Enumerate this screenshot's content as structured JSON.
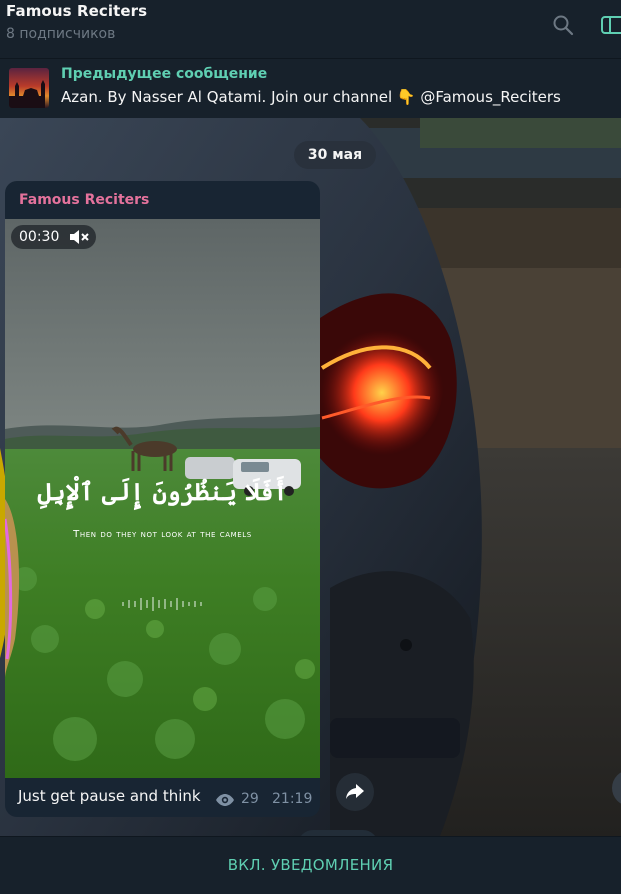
{
  "header": {
    "title": "Famous Reciters",
    "subtitle": "8 подписчиков",
    "icons": [
      "search-icon",
      "side-panel-icon"
    ]
  },
  "pinned": {
    "title": "Предыдущее сообщение",
    "text": "Azan. By Nasser Al Qatami.  Join our channel 👇 @Famous_Reciters"
  },
  "chat": {
    "date": "30 мая",
    "message": {
      "author": "Famous Reciters",
      "video_duration": "00:30",
      "video_arabic_text": "أَفَلَا يَنظُرُونَ إِلَى ٱلْإِبِلِ",
      "video_caption": "Then do they not look at the camels",
      "caption": "Just get pause and think",
      "views": "29",
      "time": "21:19"
    }
  },
  "bottom": {
    "notify_label": "ВКЛ. УВЕДОМЛЕНИЯ"
  },
  "colors": {
    "accent": "#5fcfb2",
    "author": "#e4729c",
    "background": "#17212b",
    "bubble": "#182533"
  }
}
